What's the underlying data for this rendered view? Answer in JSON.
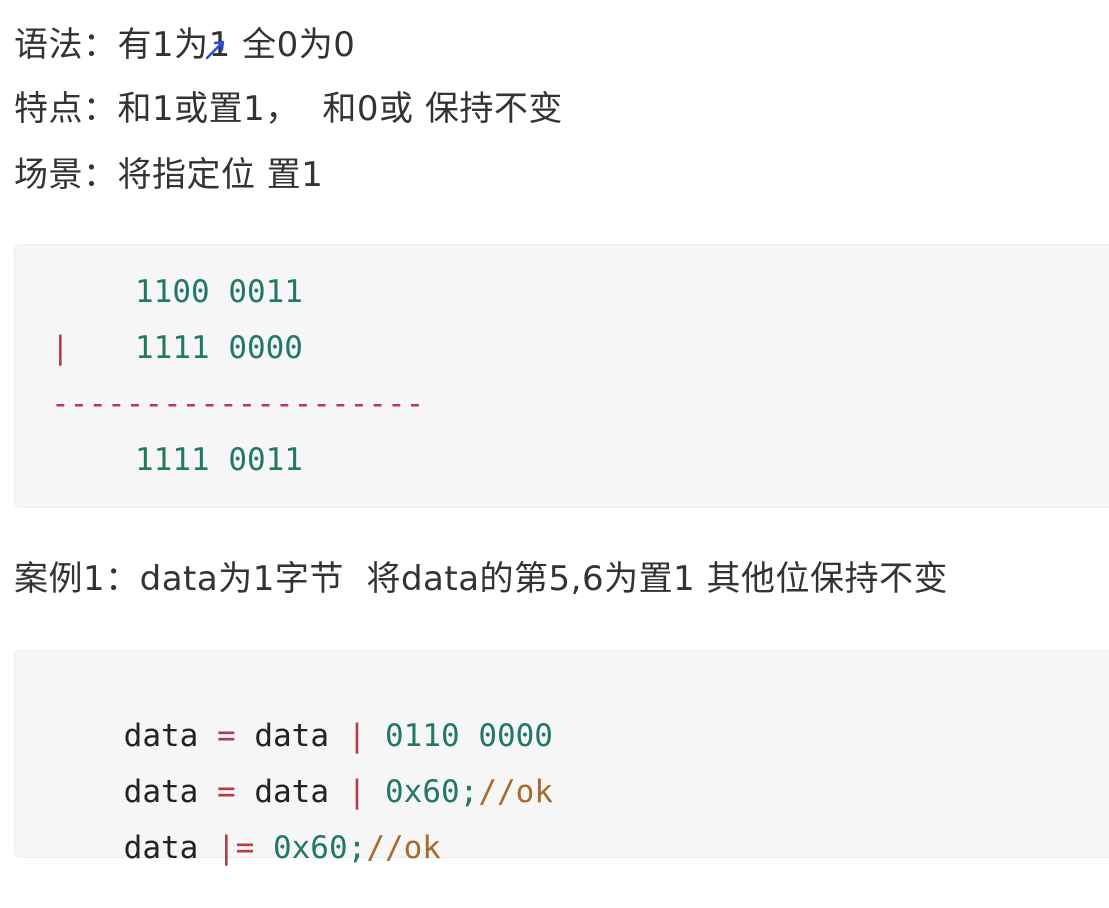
{
  "notes": {
    "syntax": "语法：有1为1 全0为0",
    "feature": "特点：和1或置1，  和0或 保持不变",
    "scene": "场景：将指定位 置1"
  },
  "example_block": {
    "row1": "1100 0011",
    "op": "|",
    "row2": "1111 0000",
    "divider": "--------------------",
    "result": "1111 0011"
  },
  "case": {
    "title": "案例1：data为1字节  将data的第5,6为置1 其他位保持不变"
  },
  "code_block": {
    "lines": [
      {
        "var": "data",
        "op1": "=",
        "var2": "data",
        "op2": "|",
        "value": "0110 0000",
        "comment": ""
      },
      {
        "var": "data",
        "op1": "=",
        "var2": "data",
        "op2": "|",
        "value": "0x60;",
        "comment": "//ok"
      },
      {
        "var": "data",
        "op1": "|=",
        "var2": "",
        "op2": "",
        "value": "0x60;",
        "comment": "//ok"
      }
    ]
  },
  "colors": {
    "number": "#217867",
    "operator": "#b73b4c",
    "comment": "#a66a2e",
    "code_bg": "#f6f6f6"
  }
}
